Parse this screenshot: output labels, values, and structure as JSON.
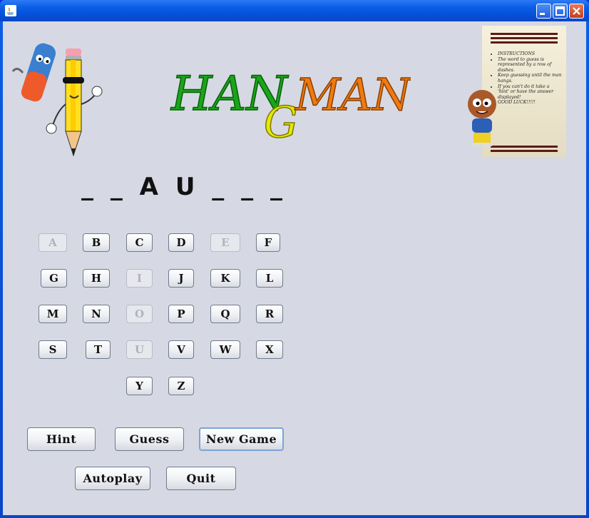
{
  "window": {
    "controls": {
      "minimize_icon": "minimize-icon",
      "maximize_icon": "maximize-icon",
      "close_icon": "close-icon"
    }
  },
  "logo": {
    "parts": [
      "HAN",
      "G",
      "MAN"
    ],
    "colors": [
      "#1aa51a",
      "#e8e800",
      "#f07a10"
    ]
  },
  "word_display": "_ _ A U _ _ _",
  "instructions": {
    "heading": "INSTRUCTIONS",
    "items": [
      "The word to guess is represented by a row of dashes.",
      "Keep guessing until the man hangs.",
      "If you can't do it take a 'hint' or have the answer displayed!",
      "GOOD LUCK!!!!!"
    ]
  },
  "letters": [
    {
      "label": "A",
      "enabled": false
    },
    {
      "label": "B",
      "enabled": true
    },
    {
      "label": "C",
      "enabled": true
    },
    {
      "label": "D",
      "enabled": true
    },
    {
      "label": "E",
      "enabled": false
    },
    {
      "label": "F",
      "enabled": true
    },
    {
      "label": "G",
      "enabled": true
    },
    {
      "label": "H",
      "enabled": true
    },
    {
      "label": "I",
      "enabled": false
    },
    {
      "label": "J",
      "enabled": true
    },
    {
      "label": "K",
      "enabled": true
    },
    {
      "label": "L",
      "enabled": true
    },
    {
      "label": "M",
      "enabled": true
    },
    {
      "label": "N",
      "enabled": true
    },
    {
      "label": "O",
      "enabled": false
    },
    {
      "label": "P",
      "enabled": true
    },
    {
      "label": "Q",
      "enabled": true
    },
    {
      "label": "R",
      "enabled": true
    },
    {
      "label": "S",
      "enabled": true
    },
    {
      "label": "T",
      "enabled": true
    },
    {
      "label": "U",
      "enabled": false
    },
    {
      "label": "V",
      "enabled": true
    },
    {
      "label": "W",
      "enabled": true
    },
    {
      "label": "X",
      "enabled": true
    },
    {
      "label": "Y",
      "enabled": true
    },
    {
      "label": "Z",
      "enabled": true
    }
  ],
  "actions": {
    "hint": "Hint",
    "guess": "Guess",
    "new_game": "New Game",
    "autoplay": "Autoplay",
    "quit": "Quit"
  }
}
